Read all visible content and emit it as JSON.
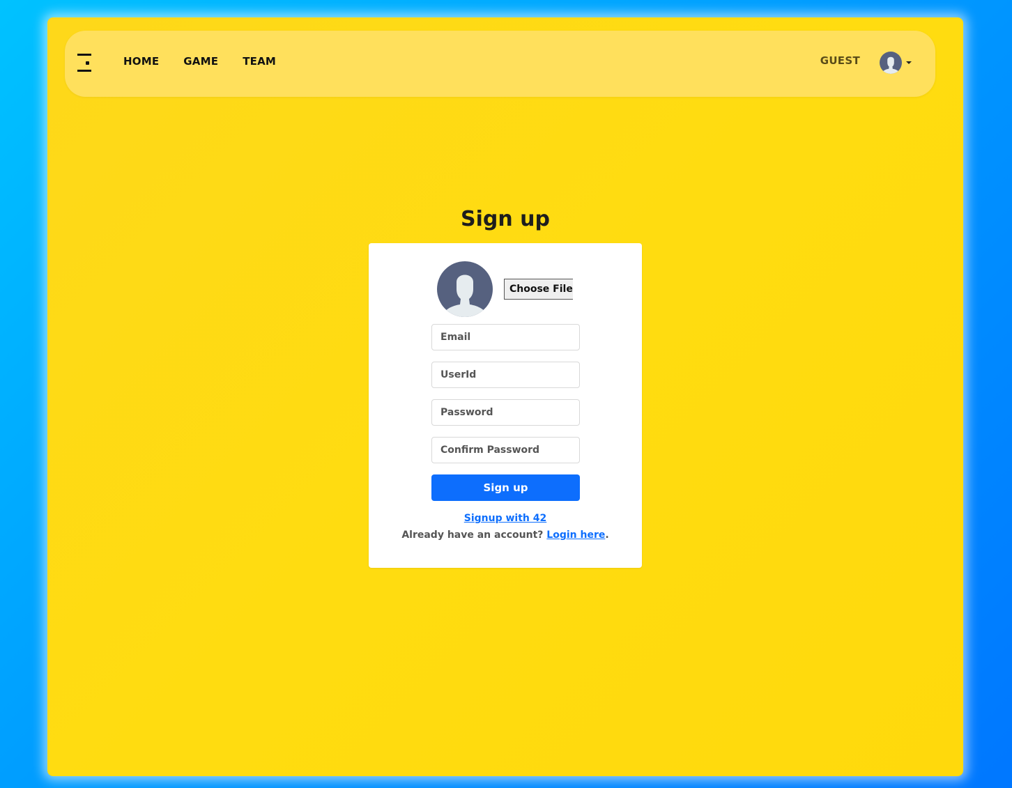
{
  "nav": {
    "logo_icon": "menu-logo-icon",
    "links": [
      "HOME",
      "GAME",
      "TEAM"
    ],
    "guest_label": "GUEST",
    "user_icon": "user-avatar-icon",
    "caret_icon": "caret-down-icon"
  },
  "signup": {
    "title": "Sign up",
    "avatar_icon": "default-avatar-icon",
    "file_button": "Choose File",
    "email_placeholder": "Email",
    "userid_placeholder": "UserId",
    "password_placeholder": "Password",
    "confirm_placeholder": "Confirm Password",
    "submit_label": "Sign up",
    "signup_42_link": "Signup with 42",
    "login_prompt": "Already have an account?",
    "login_link": "Login here",
    "login_suffix": "."
  },
  "colors": {
    "background": "#0099ff",
    "panel": "#ffd90c",
    "navbar": "#ffe05c",
    "primary": "#0d6efd",
    "avatar": "#56617f"
  }
}
